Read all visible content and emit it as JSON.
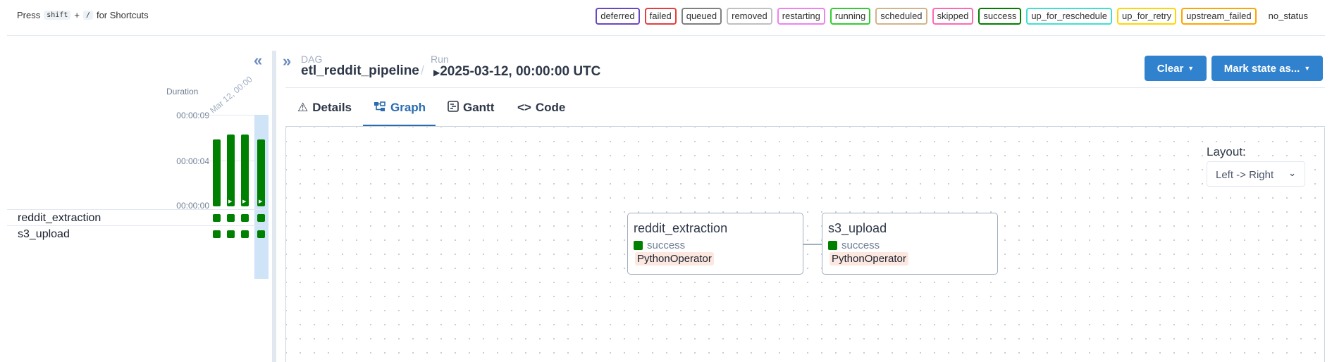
{
  "shortcuts": {
    "press": "Press",
    "key1": "shift",
    "plus": "+",
    "key2": "/",
    "suffix": "for Shortcuts"
  },
  "legend": [
    {
      "label": "deferred",
      "color": "#6b46c1"
    },
    {
      "label": "failed",
      "color": "#e53e3e"
    },
    {
      "label": "queued",
      "color": "#808080"
    },
    {
      "label": "removed",
      "color": "#c0c0c0"
    },
    {
      "label": "restarting",
      "color": "#ee82ee"
    },
    {
      "label": "running",
      "color": "#32cd32"
    },
    {
      "label": "scheduled",
      "color": "#d2b48c"
    },
    {
      "label": "skipped",
      "color": "#ff69b4"
    },
    {
      "label": "success",
      "color": "#008000"
    },
    {
      "label": "up_for_reschedule",
      "color": "#40e0d0"
    },
    {
      "label": "up_for_retry",
      "color": "#ffd700"
    },
    {
      "label": "upstream_failed",
      "color": "#ffa500"
    },
    {
      "label": "no_status",
      "color": ""
    }
  ],
  "grid": {
    "duration_label": "Duration",
    "run_date_label": "Mar 12, 00:00",
    "ticks": [
      "00:00:09",
      "00:00:04",
      "00:00:00"
    ],
    "runs": [
      {
        "duration_fraction": 0.93,
        "has_icon": false
      },
      {
        "duration_fraction": 1.0,
        "has_icon": true
      },
      {
        "duration_fraction": 1.0,
        "has_icon": true
      },
      {
        "duration_fraction": 0.93,
        "has_icon": true
      }
    ],
    "tasks": [
      {
        "name": "reddit_extraction",
        "states": [
          "success",
          "success",
          "success",
          "success"
        ]
      },
      {
        "name": "s3_upload",
        "states": [
          "success",
          "success",
          "success",
          "success"
        ]
      }
    ]
  },
  "breadcrumb": {
    "dag_label": "DAG",
    "dag_value": "etl_reddit_pipeline",
    "separator": "/",
    "run_label": "Run",
    "run_value": "2025-03-12, 00:00:00 UTC"
  },
  "actions": {
    "clear": "Clear",
    "mark_state": "Mark state as..."
  },
  "tabs": [
    {
      "label": "Details",
      "icon": "warning-icon"
    },
    {
      "label": "Graph",
      "icon": "graph-icon",
      "active": true
    },
    {
      "label": "Gantt",
      "icon": "gantt-icon"
    },
    {
      "label": "Code",
      "icon": "code-icon"
    }
  ],
  "graph": {
    "layout_label": "Layout:",
    "layout_value": "Left -> Right",
    "nodes": [
      {
        "name": "reddit_extraction",
        "state": "success",
        "operator": "PythonOperator"
      },
      {
        "name": "s3_upload",
        "state": "success",
        "operator": "PythonOperator"
      }
    ]
  },
  "colors": {
    "accent": "#3182ce",
    "success": "#008000",
    "operator_bg": "#fde8e1"
  }
}
